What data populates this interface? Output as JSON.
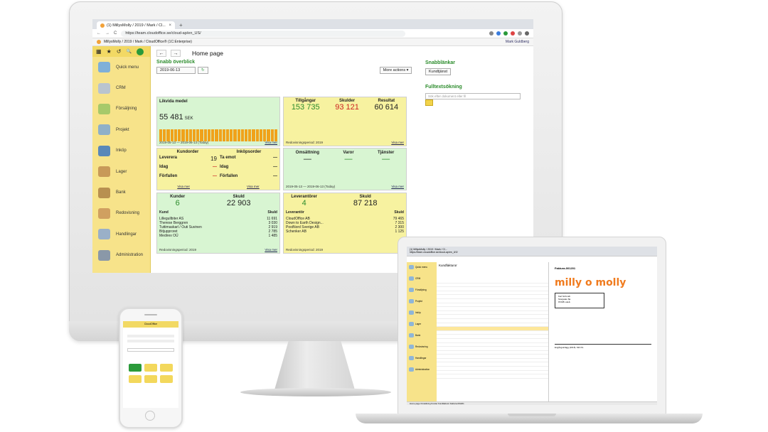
{
  "browser": {
    "tab_title": "(1) MillysMolly / 2019 / Mark / Cl...",
    "tab_close": "×",
    "tab_new": "+",
    "url": "https://team.cloudoffice.se/cloud-ap/en_US/",
    "app_breadcrumb": "MillysMolly / 2019 / Mark / CloudOffice® (1C:Enterprise)",
    "user": "Mark Guldberg",
    "nav_back": "←",
    "nav_forward": "→",
    "reload": "C"
  },
  "sidebar": {
    "top_icons": [
      "▦",
      "★",
      "↺",
      "🔍"
    ],
    "items": [
      {
        "label": "Quick menu",
        "color": "#7fb0d8"
      },
      {
        "label": "CRM",
        "color": "#b9c4cf"
      },
      {
        "label": "Försäljning",
        "color": "#a7c96a"
      },
      {
        "label": "Projekt",
        "color": "#8fb0c8"
      },
      {
        "label": "Inköp",
        "color": "#5a88b8"
      },
      {
        "label": "Lager",
        "color": "#c89a58"
      },
      {
        "label": "Bank",
        "color": "#b89050"
      },
      {
        "label": "Redovisning",
        "color": "#d0a060"
      },
      {
        "label": "Handlingar",
        "color": "#9ab0c8"
      },
      {
        "label": "Administration",
        "color": "#8a98a8"
      }
    ]
  },
  "main": {
    "back": "←",
    "forward": "→",
    "page_title": "Home page",
    "snabb": "Snabb överblick",
    "date": "2019-06-13",
    "more_actions": "More actions ▾",
    "likvida": {
      "label": "Likvida medel",
      "amount": "55 481",
      "currency": "SEK",
      "period": "2019-05-13 — 2019-06-13 (Today)",
      "link": "Visa mer"
    },
    "balance": {
      "tillgangar_label": "Tillgångar",
      "tillgangar": "153 735",
      "skulder_label": "Skulder",
      "skulder": "93 121",
      "resultat_label": "Resultat",
      "resultat": "60 614",
      "period": "Redovisningsperiod: 2019",
      "link": "Visa mer"
    },
    "orders": {
      "kundorder": "Kundorder",
      "inkopsorder": "Inköpsorder",
      "leverera": "Leverera",
      "leverera_val": "19",
      "ta_emot": "Ta emot",
      "ta_emot_val": "—",
      "idag": "Idag",
      "idag_val": "—",
      "idag2": "Idag",
      "idag2_val": "—",
      "forfallen": "Förfallen",
      "forfallen_val": "—",
      "forfallen2": "Förfallen",
      "forfallen2_val": "—",
      "link": "Visa mer"
    },
    "omsattning": {
      "omsattning_label": "Omsättning",
      "omsattning": "—",
      "varor_label": "Varor",
      "varor": "—",
      "tjanster_label": "Tjänster",
      "tjanster": "—",
      "period": "2019-05-13 — 2019-06-13 (Today)",
      "link": "Visa mer"
    },
    "kunder": {
      "kunder_label": "Kunder",
      "kunder": "6",
      "skuld_label": "Skuld",
      "skuld": "22 903",
      "col1": "Kund",
      "col2": "Skuld",
      "rows": [
        {
          "name": "Lillegullbiter AS",
          "value": "11 691"
        },
        {
          "name": "Therese Berggren",
          "value": "3 030"
        },
        {
          "name": "Tuttimaskarl / Outi Suvinen",
          "value": "2 919"
        },
        {
          "name": "Bitjupproret",
          "value": "2 785"
        },
        {
          "name": "Medirex OÜ",
          "value": "1 485"
        }
      ],
      "period": "Redovisningsperiod: 2019",
      "link": "Visa mer"
    },
    "leverantorer": {
      "label": "Leverantörer",
      "count": "4",
      "skuld_label": "Skuld",
      "skuld": "87 218",
      "col1": "Leverantör",
      "col2": "Skuld",
      "rows": [
        {
          "name": "CloudOffice AB",
          "value": "79 465"
        },
        {
          "name": "Down to Earth Design...",
          "value": "7 315"
        },
        {
          "name": "PostNord Sverige AB",
          "value": "2 300"
        },
        {
          "name": "Schenker AB",
          "value": "1 125"
        }
      ],
      "period": "Redovisningsperiod: 2019"
    },
    "snabblankar": "Snabblänkar",
    "kundtjanst": "Kundtjänst",
    "fulltext": "Fulltextsökning",
    "search_placeholder": "Sök efter dokument eller fil"
  },
  "laptop": {
    "tab_title": "(1) MillysMolly / 2019 / Mark / Cl...",
    "url": "https://team.cloudoffice.se/cloud-ap/en_US/",
    "list_title": "Kundfakturor",
    "doc_title": "Faktura-001201",
    "brand": "milly o molly",
    "address_name": "Karl Schmidt",
    "address_street": "Storgatan 8a",
    "address_city": "97238 Luleå",
    "line_item": "Engångsinlägg (2018). M/L/XL",
    "side_items": [
      "Quick menu",
      "CRM",
      "Försäljning",
      "Projekt",
      "Inköp",
      "Lager",
      "Bank",
      "Redovisning",
      "Handlingar",
      "Administration"
    ],
    "status": "Home page  Omsättning  Kunder  Kundfakturor  Faktura-001201"
  },
  "phone": {
    "title": "CloudOffice"
  }
}
